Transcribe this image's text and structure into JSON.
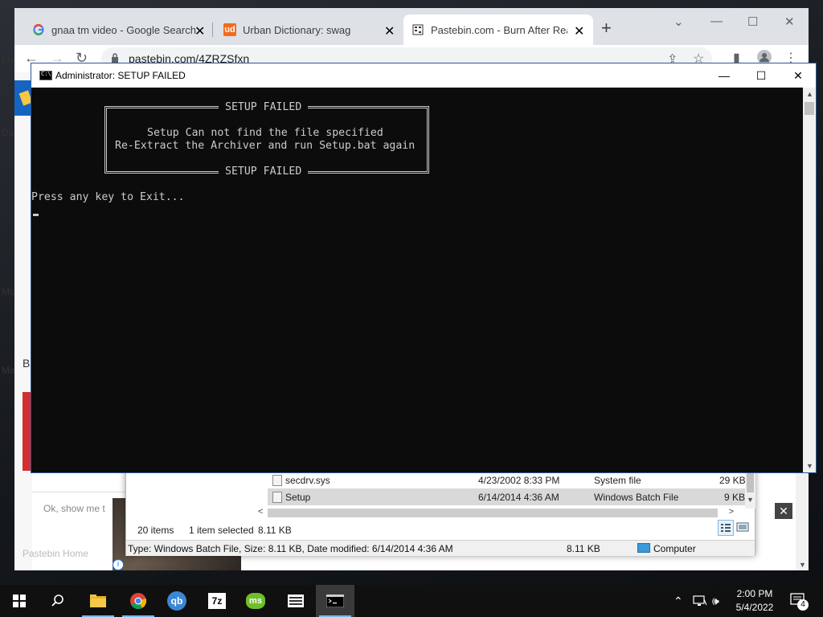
{
  "browser": {
    "tabs": [
      {
        "label": "gnaa tm video - Google Search",
        "icon": "google-g-icon"
      },
      {
        "label": "Urban Dictionary: swag",
        "icon": "urban-dictionary-icon",
        "favicon_text": "ud"
      },
      {
        "label": "Pastebin.com - Burn After Read",
        "icon": "pastebin-icon"
      }
    ],
    "url": "pastebin.com/4ZRZSfxn",
    "page_fragments": {
      "left_1": "My",
      "left_2": "Da",
      "left_3": "Mo",
      "left_4": "B",
      "left_5": "Me",
      "ok_button": "Ok, show me t",
      "pastebin_home": "Pastebin Home"
    }
  },
  "explorer": {
    "files": [
      {
        "name": "secdrv.sys",
        "date": "4/23/2002 8:33 PM",
        "type": "System file",
        "size": "29 KB",
        "selected": false
      },
      {
        "name": "Setup",
        "date": "6/14/2014 4:36 AM",
        "type": "Windows Batch File",
        "size": "9 KB",
        "selected": true
      }
    ],
    "status": {
      "count": "20 items",
      "selection": "1 item selected",
      "sel_size": "8.11 KB"
    },
    "details": {
      "text": "Type: Windows Batch File, Size: 8.11 KB, Date modified: 6/14/2014 4:36 AM",
      "size": "8.11 KB",
      "location": "Computer"
    }
  },
  "cmd": {
    "title": "Administrator:  SETUP FAILED",
    "box_caption": "SETUP FAILED",
    "box_line1": "Setup Can not find the file specified",
    "box_line2": "Re-Extract the Archiver and run Setup.bat again",
    "prompt": "Press any key to Exit..."
  },
  "taskbar": {
    "apps": [
      "file-explorer",
      "google-chrome",
      "qbittorrent",
      "7-zip",
      "mcafee-ms",
      "task-list",
      "command-prompt"
    ],
    "qb_label": "qb",
    "sevenzip_label": "7z",
    "ms_label": "ms",
    "time": "2:00 PM",
    "date": "5/4/2022",
    "notifications": "4"
  },
  "colors": {
    "cmd_bg": "#0c0c0c",
    "cmd_text": "#cccccc",
    "chrome_tabstrip": "#dee1e6",
    "taskbar": "#101010",
    "accent": "#76b9ed"
  }
}
